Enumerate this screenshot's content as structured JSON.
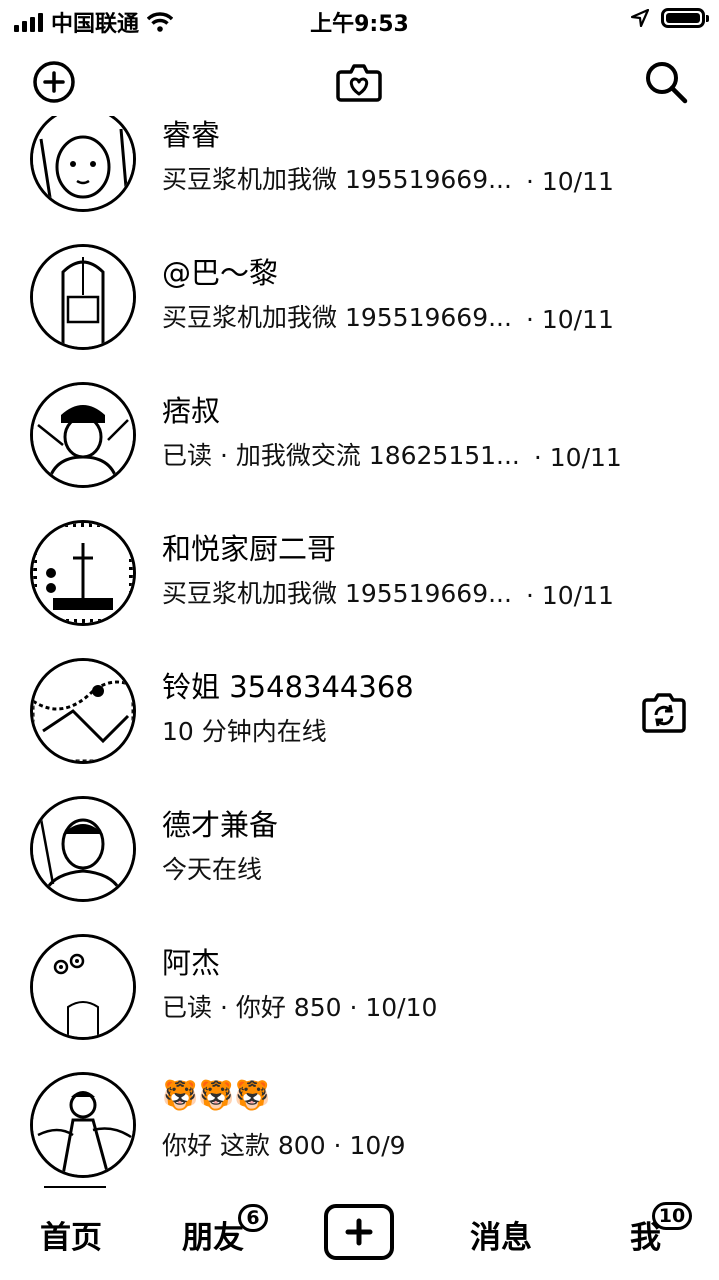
{
  "status_bar": {
    "carrier": "中国联通",
    "time": "上午9:53",
    "icons": [
      "signal-icon",
      "wifi-icon",
      "location-icon",
      "battery-icon"
    ]
  },
  "top_nav": {
    "icons": [
      "add-circle-icon",
      "heart-camera-icon",
      "search-icon"
    ]
  },
  "conversations": [
    {
      "name": "睿睿",
      "message": "买豆浆机加我微 195519669...",
      "date": "· 10/11"
    },
    {
      "name": "@巴～黎",
      "message": "买豆浆机加我微 195519669...",
      "date": "· 10/11"
    },
    {
      "name": "痞叔",
      "message": "已读 · 加我微交流 18625151...",
      "date": "· 10/11"
    },
    {
      "name": "和悦家厨二哥",
      "message": "买豆浆机加我微 195519669...",
      "date": "· 10/11"
    },
    {
      "name": "铃姐 3548344368",
      "message": "10 分钟内在线",
      "date": ""
    },
    {
      "name": "德才兼备",
      "message": "今天在线",
      "date": ""
    },
    {
      "name": "阿杰",
      "message": "已读 · 你好 850 · 10/10",
      "date": ""
    },
    {
      "name": "🐯🐯🐯",
      "message": "你好 这款 800 · 10/9",
      "date": ""
    }
  ],
  "tabbar": {
    "home": "首页",
    "friends": "朋友",
    "friends_badge": "6",
    "messages": "消息",
    "me": "我",
    "me_badge": "10"
  }
}
